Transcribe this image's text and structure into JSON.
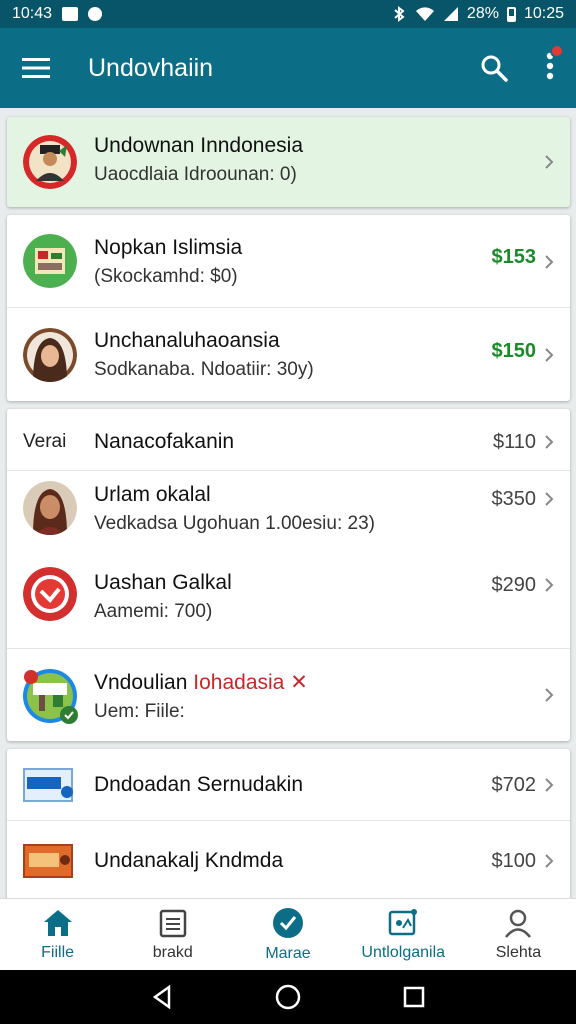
{
  "status_bar": {
    "time_left": "10:43",
    "battery": "28%",
    "time_right": "10:25"
  },
  "app_bar": {
    "title": "Undovhaiin"
  },
  "items": [
    {
      "name": "Undownan Inndonesia",
      "sub": "Uaocdlaia Idroounan: 0)",
      "price": ""
    },
    {
      "name": "Nopkan Islimsia",
      "sub": "(Skockamhd: $0)",
      "price": "$153"
    },
    {
      "name": "Unchanaluhaoansia",
      "sub": "Sodkanaba. Ndoatiir: 30y)",
      "price": "$150"
    },
    {
      "label": "Verai",
      "name": "Nanacofakanin",
      "price": "$110"
    },
    {
      "name": "Urlam okalal",
      "sub": "Vedkadsa Ugohuan 1.00esiu: 23)",
      "price": "$350"
    },
    {
      "name": "Uashan Galkal",
      "sub": "Aamemi: 700)",
      "price": "$290"
    },
    {
      "name_a": "Vndoulian",
      "name_b": "Iohadasia",
      "sub": "Uem: Fiile:",
      "price": ""
    },
    {
      "name": "Dndoadan Sernudakin",
      "price": "$702"
    },
    {
      "name": "Undanakalj Kndmda",
      "price": "$100"
    }
  ],
  "bottom_nav": [
    {
      "label": "Fiille"
    },
    {
      "label": "brakd"
    },
    {
      "label": "Marae"
    },
    {
      "label": "Untlolganila"
    },
    {
      "label": "Slehta"
    }
  ],
  "colors": {
    "appbar": "#0b6e86",
    "statusbar": "#08556a",
    "highlight_row": "#e3f4e3",
    "price_green": "#1a8a2a"
  }
}
